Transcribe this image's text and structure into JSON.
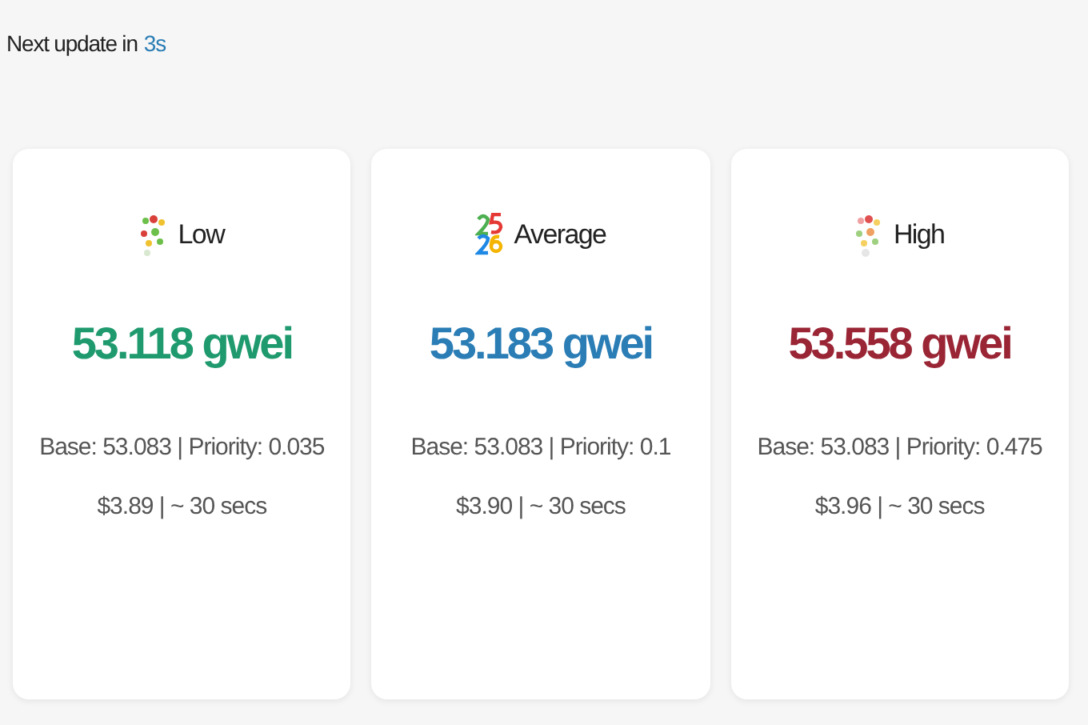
{
  "header": {
    "label": "Next update in",
    "countdown": "3s"
  },
  "cards": [
    {
      "kind": "low",
      "label": "Low",
      "price": "53.118 gwei",
      "color": "#1f9a6e",
      "detail": "Base: 53.083 | Priority: 0.035",
      "cost": "$3.89 | ~ 30 secs"
    },
    {
      "kind": "average",
      "label": "Average",
      "price": "53.183 gwei",
      "color": "#2a7db5",
      "detail": "Base: 53.083 | Priority: 0.1",
      "cost": "$3.90 | ~ 30 secs"
    },
    {
      "kind": "high",
      "label": "High",
      "price": "53.558 gwei",
      "color": "#9a2535",
      "detail": "Base: 53.083 | Priority: 0.475",
      "cost": "$3.96 | ~ 30 secs"
    }
  ]
}
